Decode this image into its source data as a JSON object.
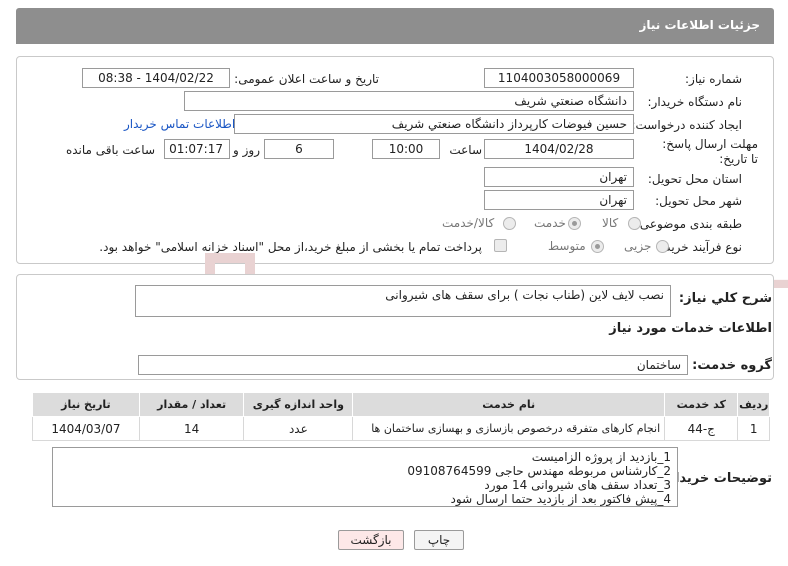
{
  "header": {
    "title": "جزئیات اطلاعات نیاز"
  },
  "form": {
    "need_number_label": "شماره نیاز:",
    "need_number": "1104003058000069",
    "announce_label": "تاریخ و ساعت اعلان عمومی:",
    "announce_value": "1404/02/22 - 08:38",
    "buyer_org_label": "نام دستگاه خریدار:",
    "buyer_org": "دانشگاه صنعتي شريف",
    "creator_label": "ایجاد کننده درخواست:",
    "creator": "حسین فیوضات کارپرداز دانشگاه صنعتي شريف",
    "contact_link": "اطلاعات تماس خریدار",
    "deadline_label": "مهلت ارسال پاسخ: تا تاریخ:",
    "deadline_date": "1404/02/28",
    "time_label": "ساعت",
    "deadline_time": "10:00",
    "days_value": "6",
    "days_label": "روز و",
    "remaining_time": "01:07:17",
    "remaining_label": "ساعت باقی مانده",
    "province_label": "استان محل تحویل:",
    "province": "تهران",
    "city_label": "شهر محل تحویل:",
    "city": "تهران",
    "category_label": "طبقه بندی موضوعی:",
    "category_options": [
      "کالا",
      "خدمت",
      "کالا/خدمت"
    ],
    "category_selected": "خدمت",
    "process_label": "نوع فرآیند خرید :",
    "process_options": [
      "جزیی",
      "متوسط"
    ],
    "process_selected": "متوسط",
    "payment_note": "پرداخت تمام یا بخشی از مبلغ خرید،از محل \"اسناد خزانه اسلامی\" خواهد بود."
  },
  "need_summary": {
    "label": "شرح کلي نياز:",
    "value": "نصب لایف لاین (طناب نجات ) برای سقف های شیروانی"
  },
  "services": {
    "section_title": "اطلاعات خدمات مورد نیاز",
    "group_label": "گروه خدمت:",
    "group_value": "ساختمان",
    "columns": [
      "ردیف",
      "کد خدمت",
      "نام خدمت",
      "واحد اندازه گیری",
      "تعداد / مقدار",
      "تاریخ نیاز"
    ],
    "rows": [
      [
        "1",
        "ج-44",
        "انجام کارهای متفرقه درخصوص بازسازی و بهسازی ساختمان ها",
        "عدد",
        "14",
        "1404/03/07"
      ]
    ]
  },
  "buyer_notes": {
    "label": "توضیحات خریدار:",
    "lines": [
      "1_بازدید از پروژه الزامیست",
      "2_کارشناس مربوطه مهندس حاجی 09108764599",
      "3_تعداد سقف های شیروانی 14 مورد",
      "4_پیش فاکتور بعد از بازدید حتما ارسال شود"
    ]
  },
  "buttons": {
    "print": "چاپ",
    "back": "بازگشت"
  },
  "watermark": {
    "text": "AriaTender.neT"
  },
  "colors": {
    "header": "#8e8e8e",
    "link": "#1a56c4",
    "back_button": "#fde8e8",
    "watermark": "#e9d2d2"
  }
}
